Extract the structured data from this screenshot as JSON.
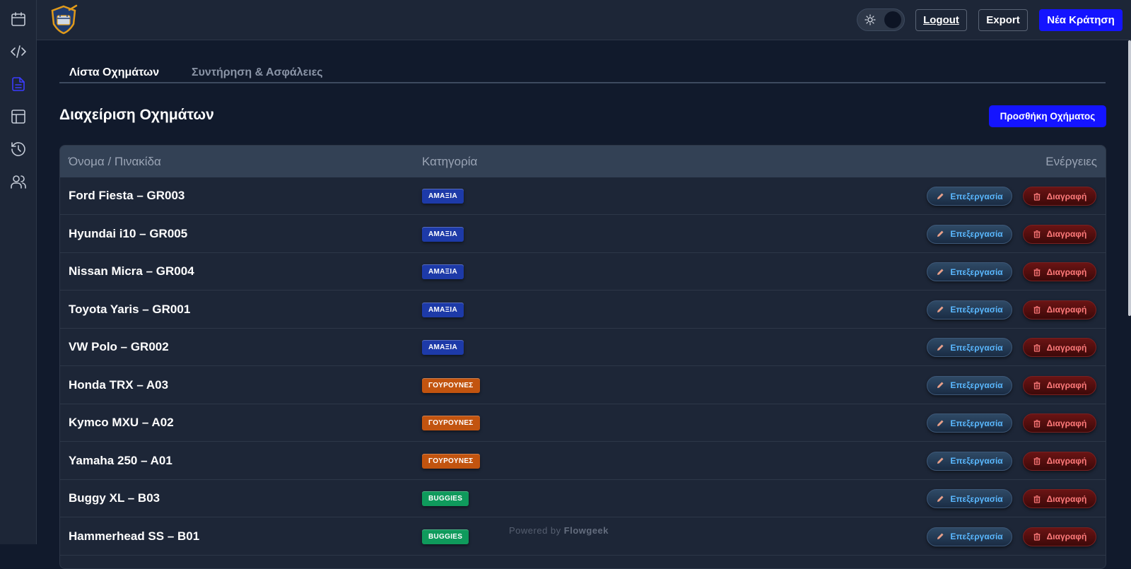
{
  "sidebar": {
    "items": [
      {
        "icon": "calendar-icon",
        "name": "sidebar-item-calendar",
        "active": false
      },
      {
        "icon": "code-icon",
        "name": "sidebar-item-code",
        "active": false
      },
      {
        "icon": "document-icon",
        "name": "sidebar-item-documents",
        "active": true
      },
      {
        "icon": "layout-icon",
        "name": "sidebar-item-layout",
        "active": false
      },
      {
        "icon": "history-icon",
        "name": "sidebar-item-history",
        "active": false
      },
      {
        "icon": "users-icon",
        "name": "sidebar-item-users",
        "active": false
      }
    ]
  },
  "header": {
    "logout_label": "Logout",
    "export_label": "Export",
    "new_booking_label": "Νέα Κράτηση"
  },
  "tabs": [
    {
      "label": "Λίστα Οχημάτων",
      "active": true
    },
    {
      "label": "Συντήρηση & Ασφάλειες",
      "active": false
    }
  ],
  "main": {
    "title": "Διαχείριση Οχημάτων",
    "add_vehicle_label": "Προσθήκη Οχήματος"
  },
  "table": {
    "columns": [
      "Όνομα / Πινακίδα",
      "Κατηγορία",
      "Ενέργειες"
    ],
    "edit_label": "Επεξεργασία",
    "delete_label": "Διαγραφή",
    "rows": [
      {
        "name": "Ford Fiesta – GR003",
        "category": "ΑΜΑΞΙΑ",
        "color": "#1d3aa8"
      },
      {
        "name": "Hyundai i10 – GR005",
        "category": "ΑΜΑΞΙΑ",
        "color": "#1d3aa8"
      },
      {
        "name": "Nissan Micra – GR004",
        "category": "ΑΜΑΞΙΑ",
        "color": "#1d3aa8"
      },
      {
        "name": "Toyota Yaris – GR001",
        "category": "ΑΜΑΞΙΑ",
        "color": "#1d3aa8"
      },
      {
        "name": "VW Polo – GR002",
        "category": "ΑΜΑΞΙΑ",
        "color": "#1d3aa8"
      },
      {
        "name": "Honda TRX – A03",
        "category": "ΓΟΥΡΟΥΝΕΣ",
        "color": "#c2540f"
      },
      {
        "name": "Kymco MXU – A02",
        "category": "ΓΟΥΡΟΥΝΕΣ",
        "color": "#c2540f"
      },
      {
        "name": "Yamaha 250 – A01",
        "category": "ΓΟΥΡΟΥΝΕΣ",
        "color": "#c2540f"
      },
      {
        "name": "Buggy XL – B03",
        "category": "BUGGIES",
        "color": "#0f9a5c"
      },
      {
        "name": "Hammerhead SS – B01",
        "category": "BUGGIES",
        "color": "#0f9a5c"
      }
    ]
  },
  "footer": {
    "prefix": "Powered by",
    "brand": "Flowgeek"
  }
}
